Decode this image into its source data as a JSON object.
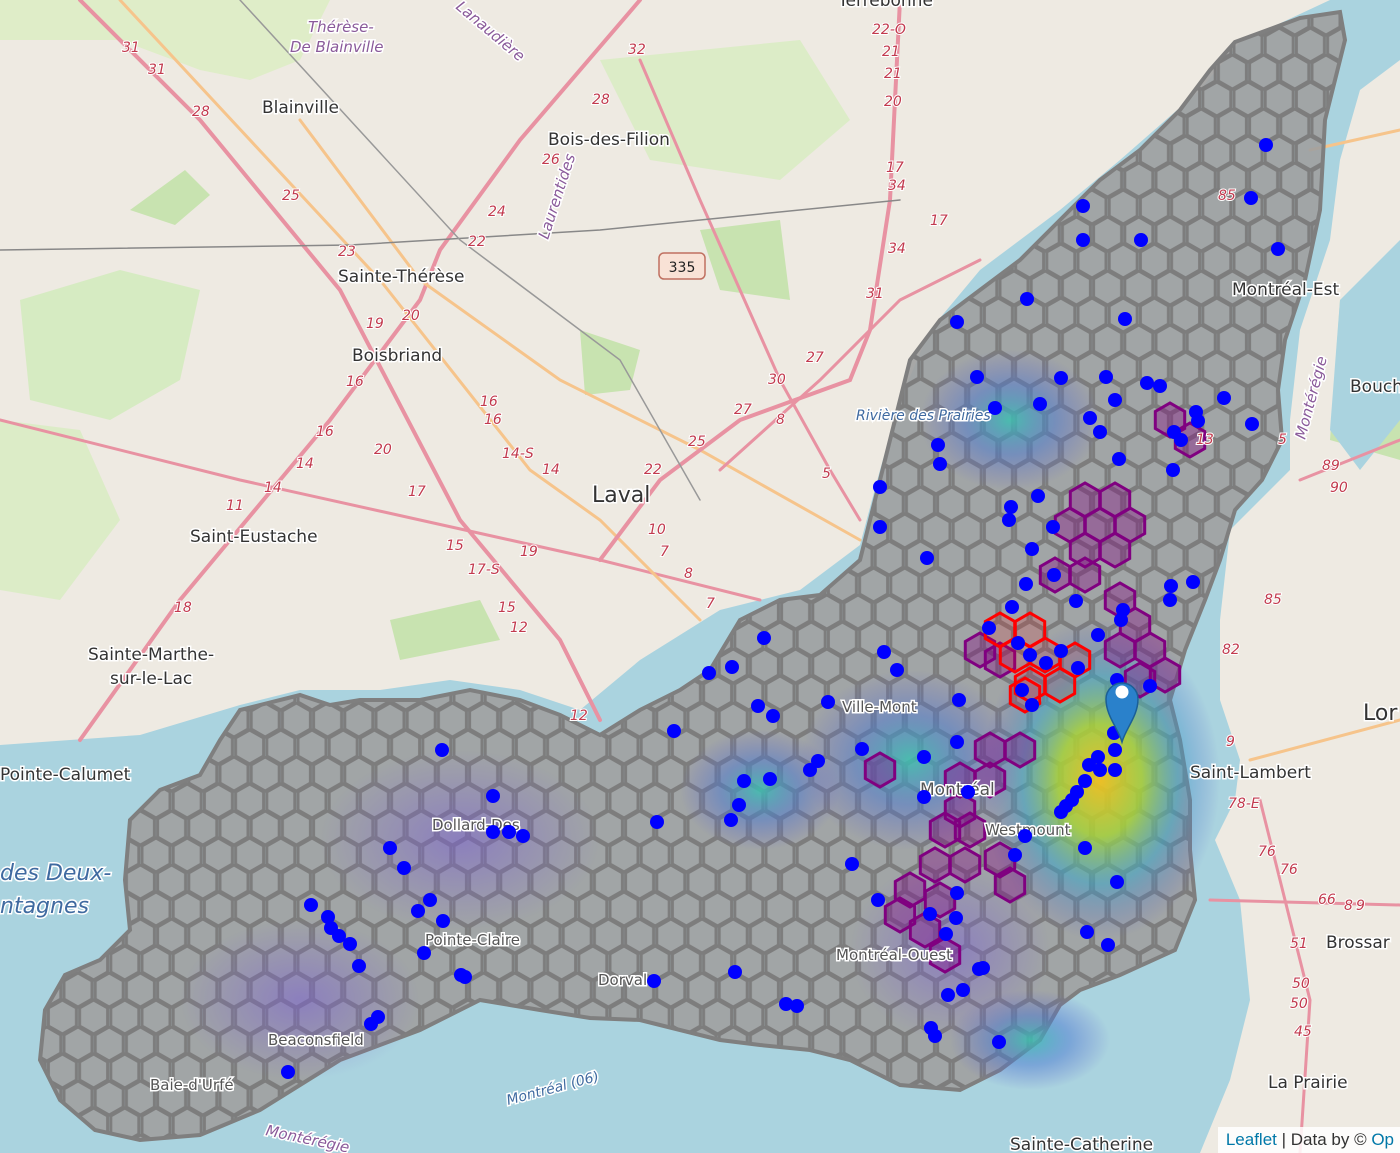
{
  "map": {
    "places": {
      "terrebonne": "Terrebonne",
      "therese": "Thérèse-",
      "de_blainville": "De Blainville",
      "lanaudiere": "Lanaudière",
      "blainville": "Blainville",
      "bois_des_filion": "Bois-des-Filion",
      "laurentides": "Laurentides",
      "sainte_therese": "Sainte-Thérèse",
      "boisbriand": "Boisbriand",
      "riviere_prairies": "Rivière des Prairies",
      "laval": "Laval",
      "saint_eustache": "Saint-Eustache",
      "sainte_marthe": "Sainte-Marthe-",
      "sur_le_lac": "sur-le-Lac",
      "pointe_calumet": "Pointe-Calumet",
      "des_deux": "des Deux-",
      "montagnes": "ntagnes",
      "montreal_est": "Montréal-Est",
      "boucherville": "Bouch",
      "longueuil": "Lor",
      "saint_lambert": "Saint-Lambert",
      "brossard": "Brossar",
      "la_prairie": "La Prairie",
      "sainte_catherine": "Sainte-Catherine",
      "monteregie": "Montérégie",
      "monteregie_south": "Montérégie",
      "dorval": "Dorval",
      "dollard": "Dollard-Des",
      "pointe_claire": "Pointe-Claire",
      "beaconsfield": "Beaconsfield",
      "baie_durfe": "Baie-d'Urfé",
      "montreal": "Montréal",
      "westmount": "Westmount",
      "montreal_ouest": "Montréal-Ouest",
      "ville_mont": "Ville-Mont",
      "montreal_06": "Montréal (06)"
    },
    "shield": "335",
    "route_numbers": [
      "31",
      "31",
      "28",
      "25",
      "23",
      "19",
      "20",
      "16",
      "16",
      "20",
      "14",
      "14",
      "17",
      "11",
      "15",
      "17-S",
      "19",
      "18",
      "15",
      "12",
      "12",
      "26",
      "24",
      "22",
      "32",
      "28",
      "16",
      "16",
      "14-S",
      "14",
      "22",
      "25",
      "27",
      "30",
      "27",
      "10",
      "7",
      "8",
      "7",
      "8",
      "5",
      "17",
      "34",
      "31",
      "34",
      "22-O",
      "21",
      "21",
      "20",
      "17",
      "13",
      "5",
      "85",
      "89",
      "90",
      "85",
      "82",
      "78-E",
      "76",
      "76",
      "51",
      "50",
      "50",
      "45",
      "9",
      "66",
      "8",
      "9"
    ],
    "marker": {
      "type": "location-pin",
      "color": "#2a81cb"
    },
    "point_color": "#0000ff",
    "hex_outline_color": "#808080",
    "hex_fill_color": "#9e9e9e",
    "highlight_colors": {
      "purple": "#800080",
      "red": "#ff0000"
    }
  },
  "attribution": {
    "leaflet": "Leaflet",
    "separator": " | Data by © ",
    "osm": "Op"
  }
}
